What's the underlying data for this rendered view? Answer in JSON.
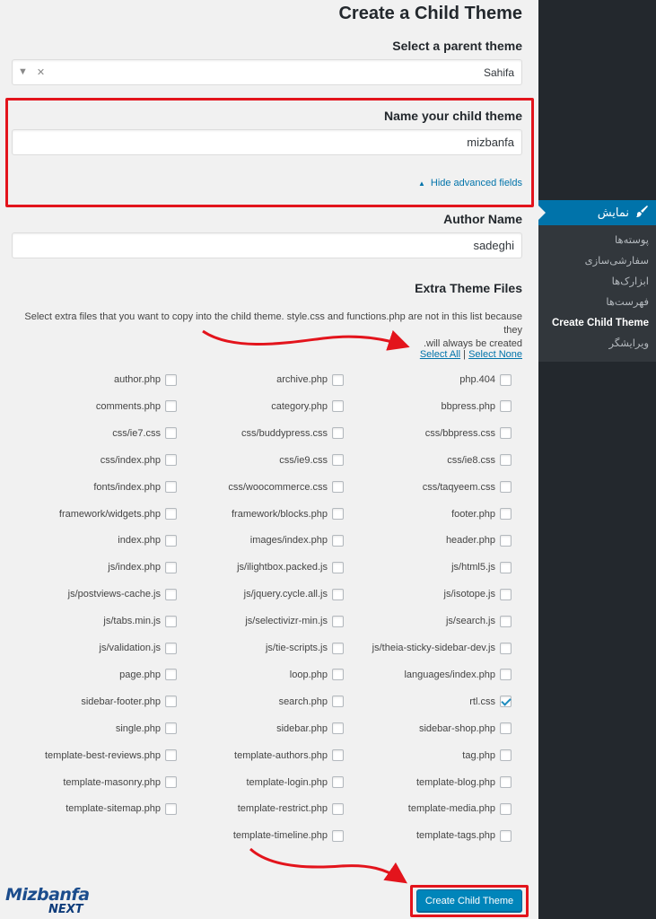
{
  "page": {
    "title": "Create a Child Theme",
    "parent_label": "Select a parent theme",
    "parent_value": "Sahifa",
    "child_label": "Name your child theme",
    "child_value": "mizbanfa",
    "advanced_link": "Hide advanced fields",
    "author_label": "Author Name",
    "author_value": "sadeghi",
    "extra_title": "Extra Theme Files",
    "extra_desc_1": "Select extra files that you want to copy into the child theme. style.css and functions.php are not in this list because they",
    "extra_desc_2": ".will always be created",
    "select_all": "Select All",
    "select_sep": "|",
    "select_none": "Select None",
    "create_button": "Create Child Theme"
  },
  "sidebar": {
    "active_label": "نمایش",
    "active_icon": "brush-icon",
    "items": [
      "پوسته‌ها",
      "سفارشی‌سازی",
      "ابزارک‌ها",
      "فهرست‌ها",
      "Create Child Theme",
      "ویرایشگر"
    ],
    "current_index": 4
  },
  "files": {
    "right": [
      "php.404",
      "bbpress.php",
      "css/bbpress.css",
      "css/ie8.css",
      "css/taqyeem.css",
      "footer.php",
      "header.php",
      "js/html5.js",
      "js/isotope.js",
      "js/search.js",
      "js/theia-sticky-sidebar-dev.js",
      "languages/index.php",
      "rtl.css",
      "sidebar-shop.php",
      "tag.php",
      "template-blog.php",
      "template-media.php",
      "template-tags.php"
    ],
    "middle": [
      "archive.php",
      "category.php",
      "css/buddypress.css",
      "css/ie9.css",
      "css/woocommerce.css",
      "framework/blocks.php",
      "images/index.php",
      "js/ilightbox.packed.js",
      "js/jquery.cycle.all.js",
      "js/selectivizr-min.js",
      "js/tie-scripts.js",
      "loop.php",
      "search.php",
      "sidebar.php",
      "template-authors.php",
      "template-login.php",
      "template-restrict.php",
      "template-timeline.php"
    ],
    "left": [
      "author.php",
      "comments.php",
      "css/ie7.css",
      "css/index.php",
      "fonts/index.php",
      "framework/widgets.php",
      "index.php",
      "js/index.php",
      "js/postviews-cache.js",
      "js/tabs.min.js",
      "js/validation.js",
      "page.php",
      "sidebar-footer.php",
      "single.php",
      "template-best-reviews.php",
      "template-masonry.php",
      "template-sitemap.php"
    ],
    "checked": [
      "rtl.css"
    ]
  },
  "logo": {
    "line1": "Mizbanfa",
    "line2": "NEXT"
  },
  "colors": {
    "accent": "#0073aa",
    "highlight": "#e3141c",
    "sidebar": "#23282d"
  }
}
